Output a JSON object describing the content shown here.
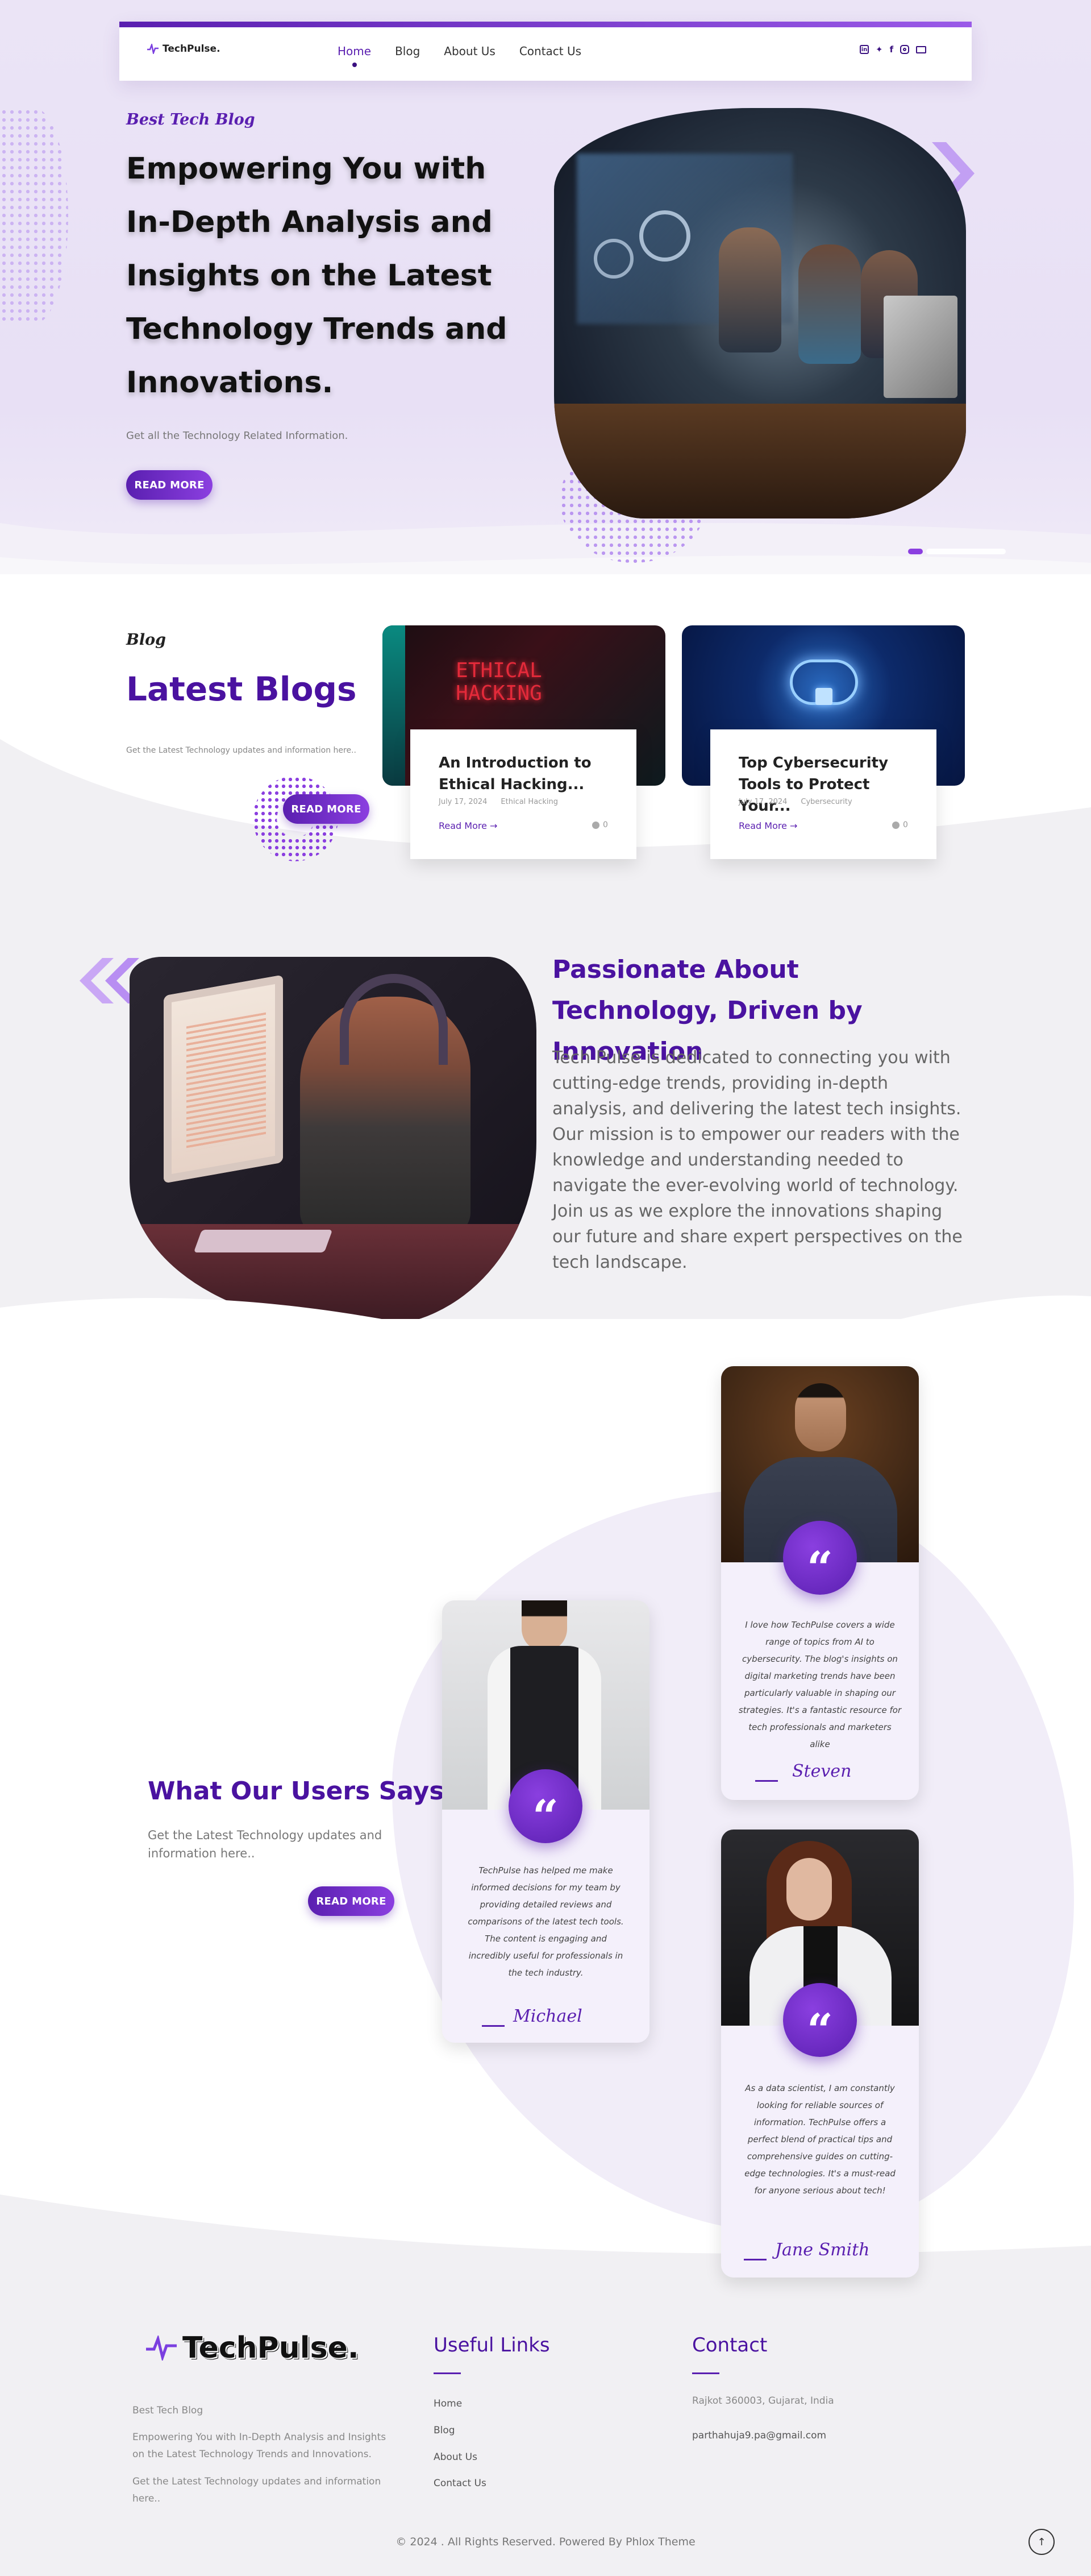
{
  "brand": {
    "logo": "TechPulse."
  },
  "nav": {
    "items": [
      "Home",
      "Blog",
      "About Us",
      "Contact Us"
    ],
    "active": "Home"
  },
  "social": [
    "linkedin-icon",
    "twitter-icon",
    "facebook-icon",
    "instagram-icon",
    "email-icon"
  ],
  "hero": {
    "kicker": "Best Tech Blog",
    "headline": "Empowering You with In-Depth Analysis and Insights on the Latest Technology Trends and Innovations.",
    "sub": "Get all the Technology Related Information.",
    "cta": "READ MORE"
  },
  "blog_section": {
    "kicker": "Blog",
    "title": "Latest Blogs",
    "sub": "Get the Latest Technology updates and information here..",
    "cta": "READ MORE",
    "posts": [
      {
        "title": "An Introduction to Ethical Hacking...",
        "date": "July 17, 2024",
        "category": "Ethical Hacking",
        "read_more": "Read More →",
        "comments": "0",
        "image_text": "ETHICAL HACKING"
      },
      {
        "title": "Top Cybersecurity Tools to Protect Your...",
        "date": "July 17, 2024",
        "category": "Cybersecurity",
        "read_more": "Read More →",
        "comments": "0"
      }
    ]
  },
  "about": {
    "title": "Passionate About Technology, Driven by Innovation",
    "body": "Tech Pulse is dedicated to connecting you with cutting-edge trends, providing in-depth analysis, and delivering the latest tech insights. Our mission is to empower our readers with the knowledge and understanding needed to navigate the ever-evolving world of technology. Join us as we explore the innovations shaping our future and share expert perspectives on the tech landscape."
  },
  "testimonials": {
    "title": "What Our Users Says",
    "sub": "Get the Latest Technology updates and information here..",
    "cta": "READ MORE",
    "items": [
      {
        "name": "Steven",
        "text": "I love how TechPulse covers a wide range of topics from AI to cybersecurity. The blog's insights on digital marketing trends have been particularly valuable in shaping our strategies. It's a fantastic resource for tech professionals and marketers alike"
      },
      {
        "name": "Michael",
        "text": "TechPulse has helped me make informed decisions for my team by providing detailed reviews and comparisons of the latest tech tools. The content is engaging and incredibly useful for professionals in the tech industry."
      },
      {
        "name": "Jane Smith",
        "text": "As a data scientist, I am constantly looking for reliable sources of information. TechPulse offers a perfect blend of practical tips and comprehensive guides on cutting-edge technologies. It's a must-read for anyone serious about tech!"
      }
    ],
    "quote_mark": "“"
  },
  "footer": {
    "brand": "TechPulse.",
    "about_lines": [
      "Best Tech Blog",
      "Empowering You with In-Depth Analysis and Insights on the Latest Technology Trends and Innovations.",
      "Get the Latest Technology updates and information here.."
    ],
    "useful_title": "Useful Links",
    "links": [
      "Home",
      "Blog",
      "About Us",
      "Contact Us"
    ],
    "contact_title": "Contact",
    "address": "Rajkot 360003, Gujarat, India",
    "email": "parthahuja9.pa@gmail.com",
    "copyright": "© 2024 . All Rights Reserved. Powered By Phlox Theme",
    "back_to_top": "↑"
  },
  "colors": {
    "accent": "#5a1fb0",
    "accent_light": "#8b3fe0",
    "hero_bg": "#ece6f6"
  }
}
